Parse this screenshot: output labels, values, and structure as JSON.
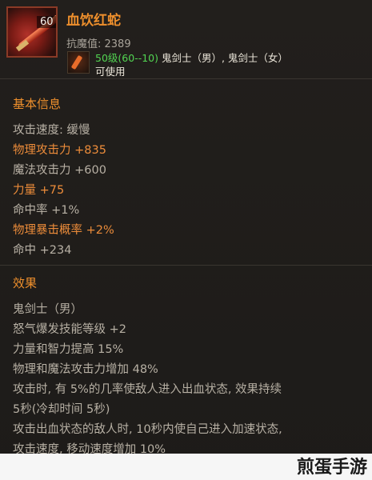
{
  "item": {
    "level": "60",
    "name": "血饮红蛇",
    "resist": "抗魔值: 2389",
    "requirement_level": "50级(60--10)",
    "requirement_class": " 鬼剑士（男）, 鬼剑士（女）",
    "usable": "可使用"
  },
  "basic": {
    "title": "基本信息",
    "stats": [
      {
        "text": "攻击速度: 缓慢",
        "style": "normal"
      },
      {
        "text": "物理攻击力 +835",
        "style": "hl"
      },
      {
        "text": "魔法攻击力 +600",
        "style": "normal"
      },
      {
        "text": "力量 +75",
        "style": "hl"
      },
      {
        "text": "命中率 +1%",
        "style": "normal"
      },
      {
        "text": "物理暴击概率 +2%",
        "style": "hl"
      },
      {
        "text": "命中 +234",
        "style": "normal"
      }
    ]
  },
  "effects": {
    "title": "效果",
    "lines": [
      "鬼剑士（男）",
      "怒气爆发技能等级 +2",
      "力量和智力提高 15%",
      "物理和魔法攻击力增加 48%",
      "攻击时, 有 5%的几率使敌人进入出血状态, 效果持续",
      "5秒(冷却时间 5秒)",
      "攻击出血状态的敌人时, 10秒内使自己进入加速状态,",
      "攻击速度, 移动速度增加 10%"
    ]
  },
  "watermark": "煎蛋手游"
}
